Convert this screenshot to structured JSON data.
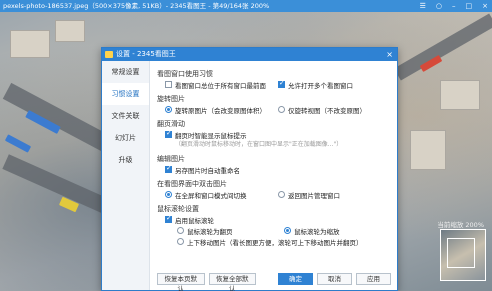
{
  "viewer": {
    "title": "pexels-photo-186537.jpeg（500×375像素, 51KB）- 2345看图王 - 第49/164张 200%",
    "controls": {
      "skin": "☰",
      "options": "○",
      "minimize": "–",
      "maximize": "□",
      "close": "×"
    },
    "zoom_label": "当前缩放 200%"
  },
  "dialog": {
    "title": "设置 - 2345看图王",
    "close": "×",
    "nav": [
      "常规设置",
      "习惯设置",
      "文件关联",
      "幻灯片",
      "升级"
    ],
    "active_nav": 1,
    "sections": {
      "open_habit": {
        "title": "看图窗口使用习惯",
        "options": [
          {
            "label": "看图窗口总位于所有窗口最前面",
            "checked": false
          },
          {
            "label": "允许打开多个看图窗口",
            "checked": true
          }
        ]
      },
      "rotate": {
        "title": "旋转图片",
        "options": [
          {
            "label": "旋转原图片（会改变原图体积）",
            "selected": true
          },
          {
            "label": "仅旋转视图（不改变原图）",
            "selected": false
          }
        ]
      },
      "page_turn": {
        "title": "翻页滑动",
        "option": {
          "label": "翻页时智能显示鼠标提示",
          "checked": true
        },
        "hint": "（翻页滑动时鼠标移动时，在窗口图中显示\"正在加载图像...\"）"
      },
      "edit": {
        "title": "编辑图片",
        "option": {
          "label": "另存图片时自动重命名",
          "checked": true
        }
      },
      "dblclick": {
        "title": "在看图界面中双击图片",
        "options": [
          {
            "label": "在全屏和窗口模式间切换",
            "selected": true
          },
          {
            "label": "返回图片管理窗口",
            "selected": false
          }
        ]
      },
      "wheel": {
        "title": "鼠标滚轮设置",
        "enable": {
          "label": "启用鼠标滚轮",
          "checked": true
        },
        "options": [
          {
            "label": "鼠标滚轮为翻页",
            "selected": false
          },
          {
            "label": "鼠标滚轮为缩放",
            "selected": true
          },
          {
            "label": "上下移动图片（看长图更方便，滚轮可上下移动图片并翻页）",
            "selected": false
          }
        ]
      }
    },
    "buttons": {
      "restore_page": "恢复本页默认",
      "restore_all": "恢复全部默认",
      "ok": "确定",
      "cancel": "取消",
      "apply": "应用"
    }
  },
  "colors": {
    "accent": "#2f82d3",
    "titlebar": "#3b8fd8"
  }
}
